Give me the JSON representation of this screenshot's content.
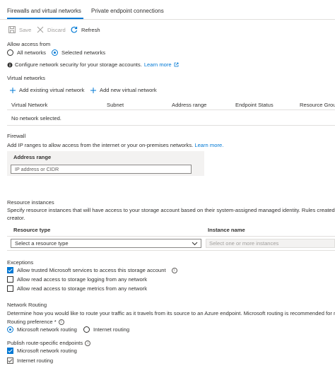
{
  "tabs": [
    {
      "label": "Firewalls and virtual networks"
    },
    {
      "label": "Private endpoint connections"
    }
  ],
  "toolbar": {
    "save": "Save",
    "discard": "Discard",
    "refresh": "Refresh"
  },
  "access": {
    "label": "Allow access from",
    "options": [
      "All networks",
      "Selected networks"
    ],
    "selected": "Selected networks",
    "info_text": "Configure network security for your storage accounts.",
    "learn_more": "Learn more"
  },
  "vnets": {
    "heading": "Virtual networks",
    "add_existing": "Add existing virtual network",
    "add_new": "Add new virtual network",
    "columns": [
      "Virtual Network",
      "Subnet",
      "Address range",
      "Endpoint Status",
      "Resource Grou"
    ],
    "empty_text": "No network selected."
  },
  "firewall": {
    "heading": "Firewall",
    "desc": "Add IP ranges to allow access from the internet or your on-premises networks.",
    "learn_more": "Learn more.",
    "column": "Address range",
    "placeholder": "IP address or CIDR"
  },
  "resource_instances": {
    "heading": "Resource instances",
    "desc_line1": "Specify resource instances that will have access to your storage account based on their system-assigned managed identity. Rules created by",
    "desc_line2": "creator.",
    "col_type": "Resource type",
    "col_instance": "Instance name",
    "type_placeholder": "Select a resource type",
    "instance_placeholder": "Select one or more instances"
  },
  "exceptions": {
    "heading": "Exceptions",
    "items": [
      {
        "label": "Allow trusted Microsoft services to access this storage account",
        "checked": true
      },
      {
        "label": "Allow read access to storage logging from any network",
        "checked": false
      },
      {
        "label": "Allow read access to storage metrics from any network",
        "checked": false
      }
    ]
  },
  "routing": {
    "heading": "Network Routing",
    "desc": "Determine how you would like to route your traffic as it travels from its source to an Azure endpoint. Microsoft routing is recommended for m",
    "preference_label": "Routing preference *",
    "options": [
      "Microsoft network routing",
      "Internet routing"
    ],
    "selected": "Microsoft network routing",
    "publish_label": "Publish route-specific endpoints",
    "publish_items": [
      {
        "label": "Microsoft network routing",
        "checked": true
      },
      {
        "label": "Internet routing",
        "checked": true
      }
    ]
  },
  "colors": {
    "accent": "#0078d4",
    "text": "#323130",
    "muted": "#a19f9d",
    "border": "#e1dfdd"
  }
}
